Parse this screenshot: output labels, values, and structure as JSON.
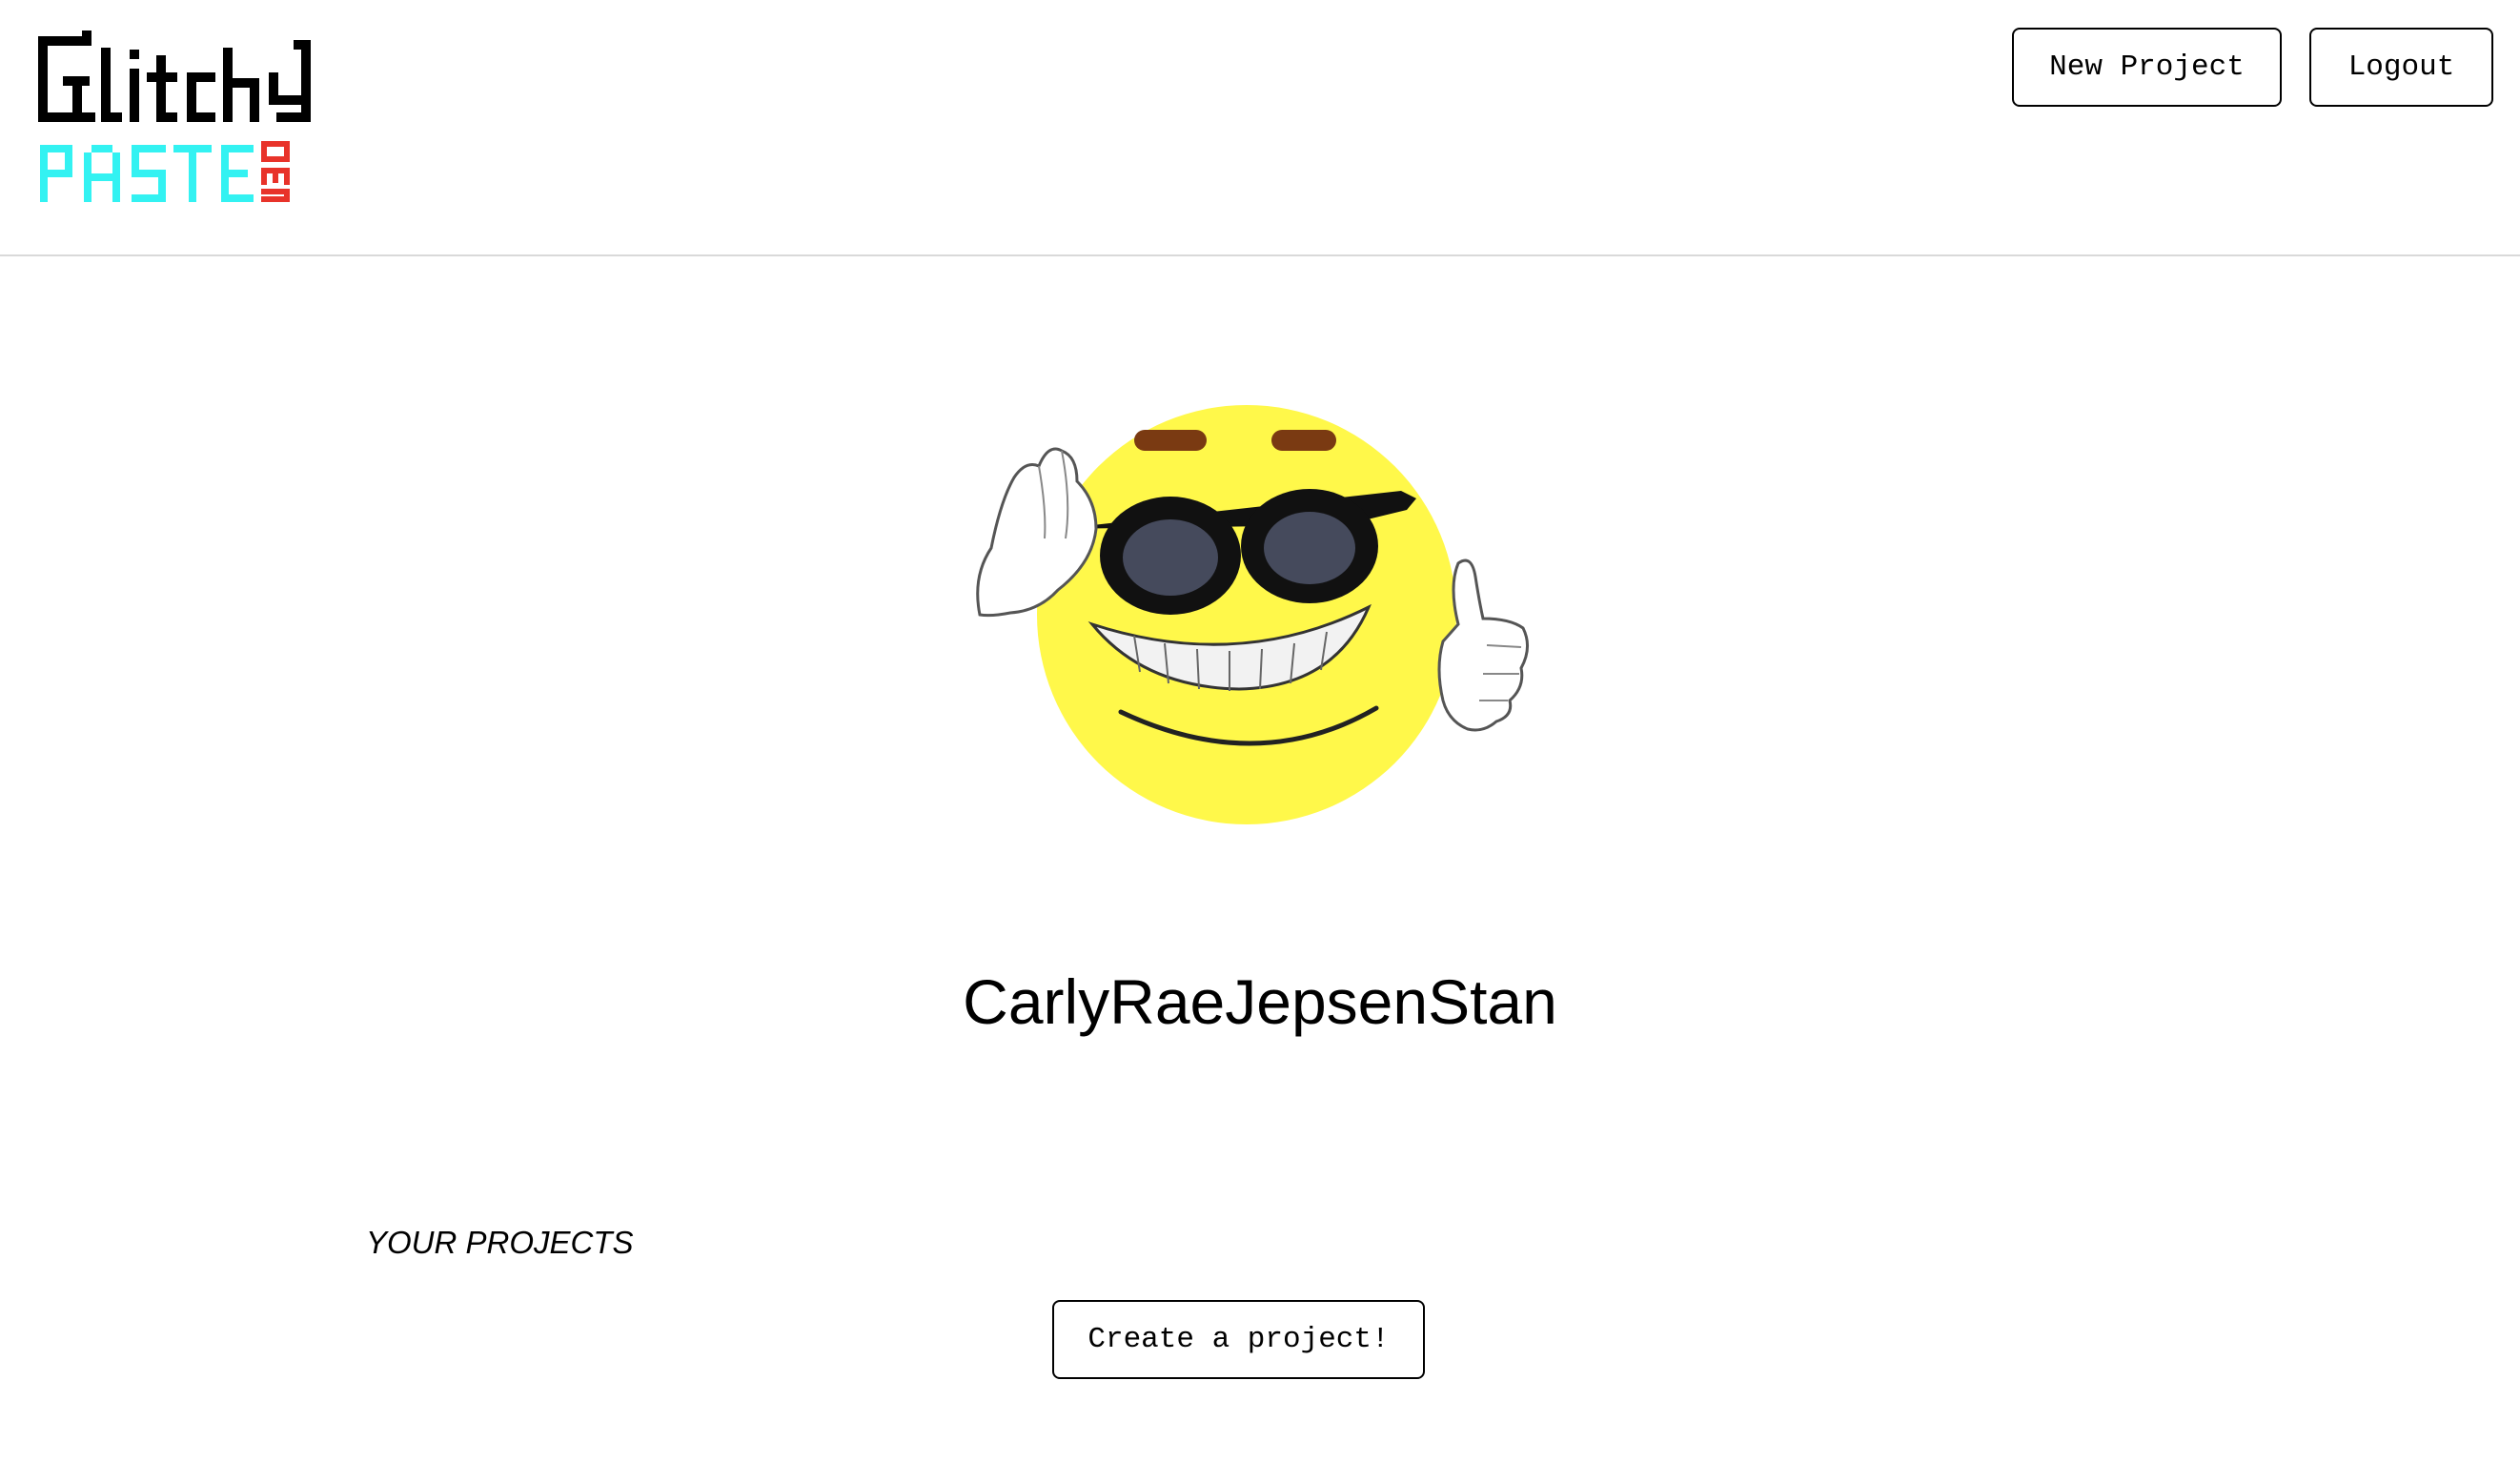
{
  "header": {
    "logo": {
      "line1": "Glitchy",
      "line2": "PASTE",
      "suffix": "DEV",
      "colors": {
        "line1": "#000000",
        "line2": "#33f2f2",
        "suffix": "#e8332a"
      }
    },
    "buttons": {
      "new_project": "New Project",
      "logout": "Logout"
    }
  },
  "profile": {
    "avatar_icon": "sunglasses-smiley-thumbs-up",
    "username": "CarlyRaeJepsenStan"
  },
  "projects": {
    "section_label": "YOUR PROJECTS",
    "create_button": "Create a project!"
  },
  "colors": {
    "border": "#000000",
    "divider": "#d9d9d9",
    "avatar_face": "#fff84a"
  }
}
